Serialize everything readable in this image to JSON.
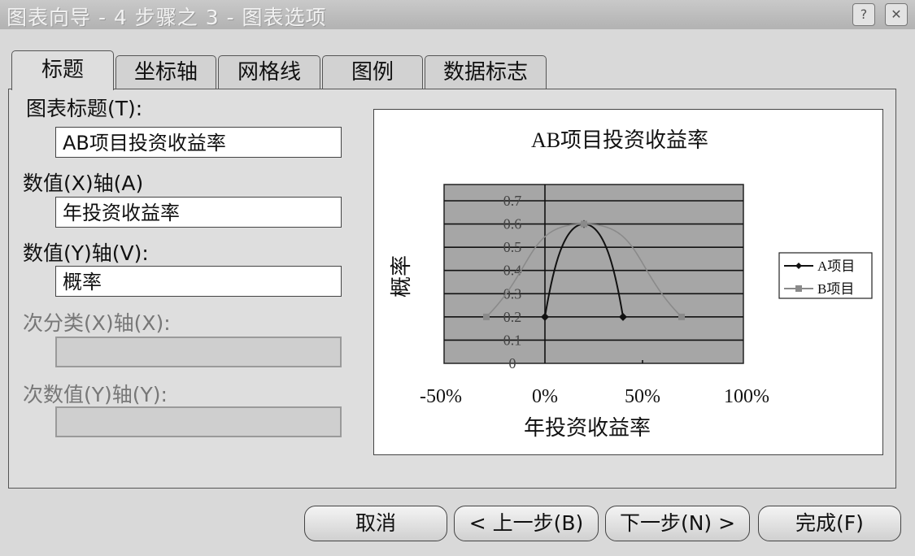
{
  "window": {
    "title": "图表向导 - 4 步骤之 3 - 图表选项",
    "help": "?",
    "close": "✕"
  },
  "tabs": [
    {
      "label": "标题"
    },
    {
      "label": "坐标轴"
    },
    {
      "label": "网格线"
    },
    {
      "label": "图例"
    },
    {
      "label": "数据标志"
    }
  ],
  "form": {
    "chart_title_label": "图表标题(T):",
    "chart_title_value": "AB项目投资收益率",
    "x_axis_label": "数值(X)轴(A)",
    "x_axis_value": "年投资收益率",
    "y_axis_label": "数值(Y)轴(V):",
    "y_axis_value": "概率",
    "x2_axis_label": "次分类(X)轴(X):",
    "x2_axis_value": "",
    "y2_axis_label": "次数值(Y)轴(Y):",
    "y2_axis_value": ""
  },
  "chart_data": {
    "type": "scatter",
    "title": "AB项目投资收益率",
    "xlabel": "年投资收益率",
    "ylabel": "概率",
    "xlim": [
      -0.5,
      1.0
    ],
    "ylim": [
      0,
      0.7
    ],
    "x_ticks": [
      "-50%",
      "0%",
      "50%",
      "100%"
    ],
    "y_ticks": [
      "0",
      "0.1",
      "0.2",
      "0.3",
      "0.4",
      "0.5",
      "0.6",
      "0.7"
    ],
    "grid": true,
    "legend_position": "right",
    "series": [
      {
        "name": "A项目",
        "color": "#111111",
        "marker": "diamond",
        "x": [
          0.0,
          0.2,
          0.4
        ],
        "y": [
          0.2,
          0.6,
          0.2
        ]
      },
      {
        "name": "B项目",
        "color": "#8a8a8a",
        "marker": "square",
        "x": [
          -0.3,
          0.2,
          0.7
        ],
        "y": [
          0.2,
          0.6,
          0.2
        ]
      }
    ]
  },
  "buttons": {
    "cancel": "取消",
    "back": "< 上一步(B)",
    "next": "下一步(N) >",
    "finish": "完成(F)"
  }
}
